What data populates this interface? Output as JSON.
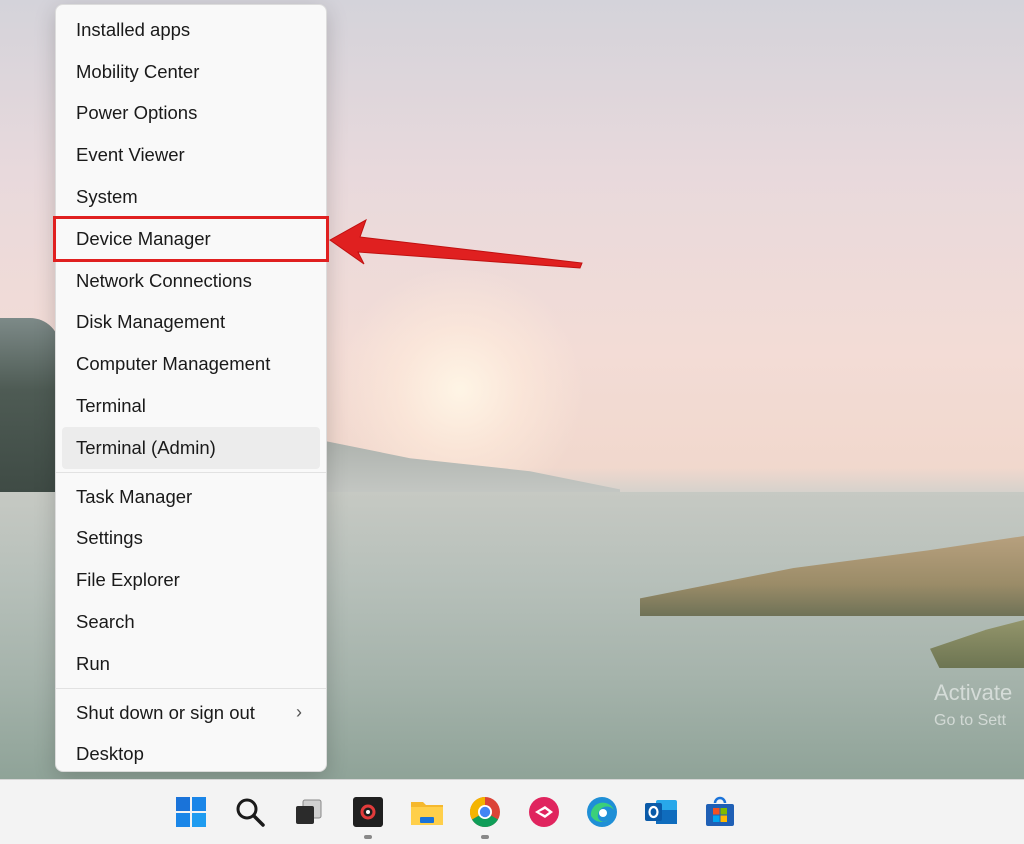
{
  "context_menu": {
    "groups": [
      [
        {
          "label": "Installed apps"
        },
        {
          "label": "Mobility Center"
        },
        {
          "label": "Power Options"
        },
        {
          "label": "Event Viewer"
        },
        {
          "label": "System"
        },
        {
          "label": "Device Manager",
          "state": "highlighted"
        },
        {
          "label": "Network Connections"
        },
        {
          "label": "Disk Management"
        },
        {
          "label": "Computer Management"
        },
        {
          "label": "Terminal"
        },
        {
          "label": "Terminal (Admin)",
          "state": "hover"
        }
      ],
      [
        {
          "label": "Task Manager"
        },
        {
          "label": "Settings"
        },
        {
          "label": "File Explorer"
        },
        {
          "label": "Search"
        },
        {
          "label": "Run"
        }
      ],
      [
        {
          "label": "Shut down or sign out",
          "submenu": true
        },
        {
          "label": "Desktop"
        }
      ]
    ]
  },
  "watermark": {
    "title": "Activate",
    "subtitle": "Go to Sett"
  },
  "taskbar": {
    "icons": [
      {
        "name": "start-icon",
        "running": false
      },
      {
        "name": "search-icon",
        "running": false
      },
      {
        "name": "task-view-icon",
        "running": false
      },
      {
        "name": "app-dark-icon",
        "running": true
      },
      {
        "name": "file-explorer-icon",
        "running": false
      },
      {
        "name": "chrome-icon",
        "running": true
      },
      {
        "name": "pink-app-icon",
        "running": false
      },
      {
        "name": "edge-icon",
        "running": false
      },
      {
        "name": "outlook-icon",
        "running": false
      },
      {
        "name": "microsoft-store-icon",
        "running": false
      }
    ]
  },
  "colors": {
    "annotation_red": "#e02020",
    "menu_background": "#f9f9f9",
    "taskbar_background": "#f3f3f3"
  }
}
